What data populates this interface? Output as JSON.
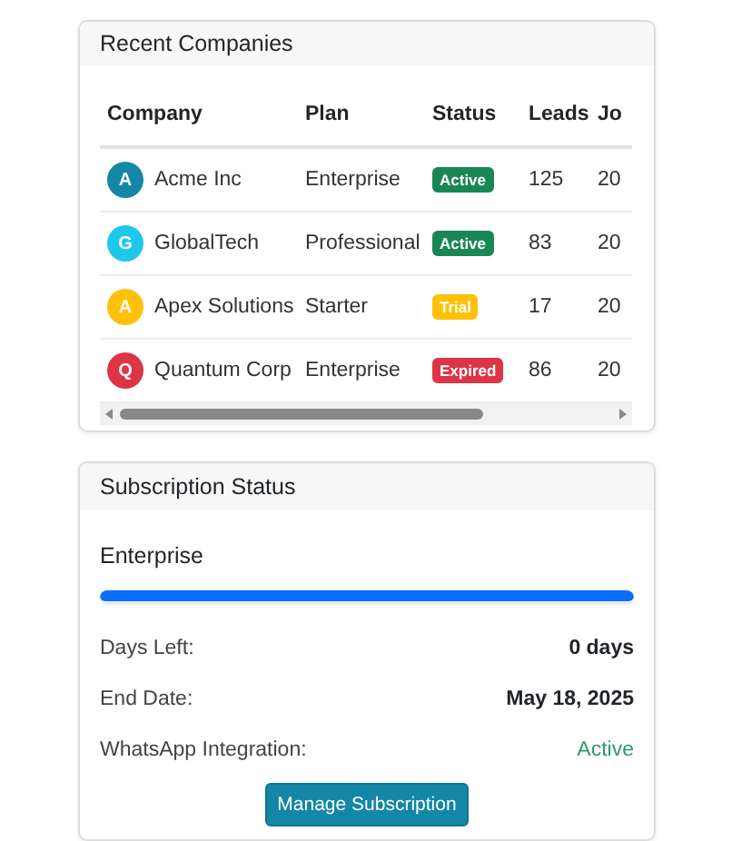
{
  "companies_card": {
    "title": "Recent Companies",
    "columns": [
      "Company",
      "Plan",
      "Status",
      "Leads",
      "Jo"
    ],
    "rows": [
      {
        "avatar": {
          "letter": "A",
          "color": "#1486a6"
        },
        "company": "Acme Inc",
        "plan": "Enterprise",
        "status": {
          "label": "Active",
          "color": "#198754"
        },
        "leads": "125",
        "column_5": "20"
      },
      {
        "avatar": {
          "letter": "G",
          "color": "#1ec8ec"
        },
        "company": "GlobalTech",
        "plan": "Professional",
        "status": {
          "label": "Active",
          "color": "#198754"
        },
        "leads": "83",
        "column_5": "20"
      },
      {
        "avatar": {
          "letter": "A",
          "color": "#ffc107"
        },
        "company": "Apex Solutions",
        "plan": "Starter",
        "status": {
          "label": "Trial",
          "color": "#ffc107"
        },
        "leads": "17",
        "column_5": "20"
      },
      {
        "avatar": {
          "letter": "Q",
          "color": "#dc3545"
        },
        "company": "Quantum Corp",
        "plan": "Enterprise",
        "status": {
          "label": "Expired",
          "color": "#dc3545"
        },
        "leads": "86",
        "column_5": "20"
      }
    ]
  },
  "subscription_card": {
    "title": "Subscription Status",
    "plan": "Enterprise",
    "level": 1,
    "details": [
      {
        "label": "Days Left:",
        "value": "0 days",
        "kind": "bold"
      },
      {
        "label": "End Date:",
        "value": "May 18, 2025",
        "kind": "bold"
      },
      {
        "label": "WhatsApp Integration:",
        "value": "Active",
        "kind": "success"
      }
    ],
    "button": "Manage Subscription"
  }
}
